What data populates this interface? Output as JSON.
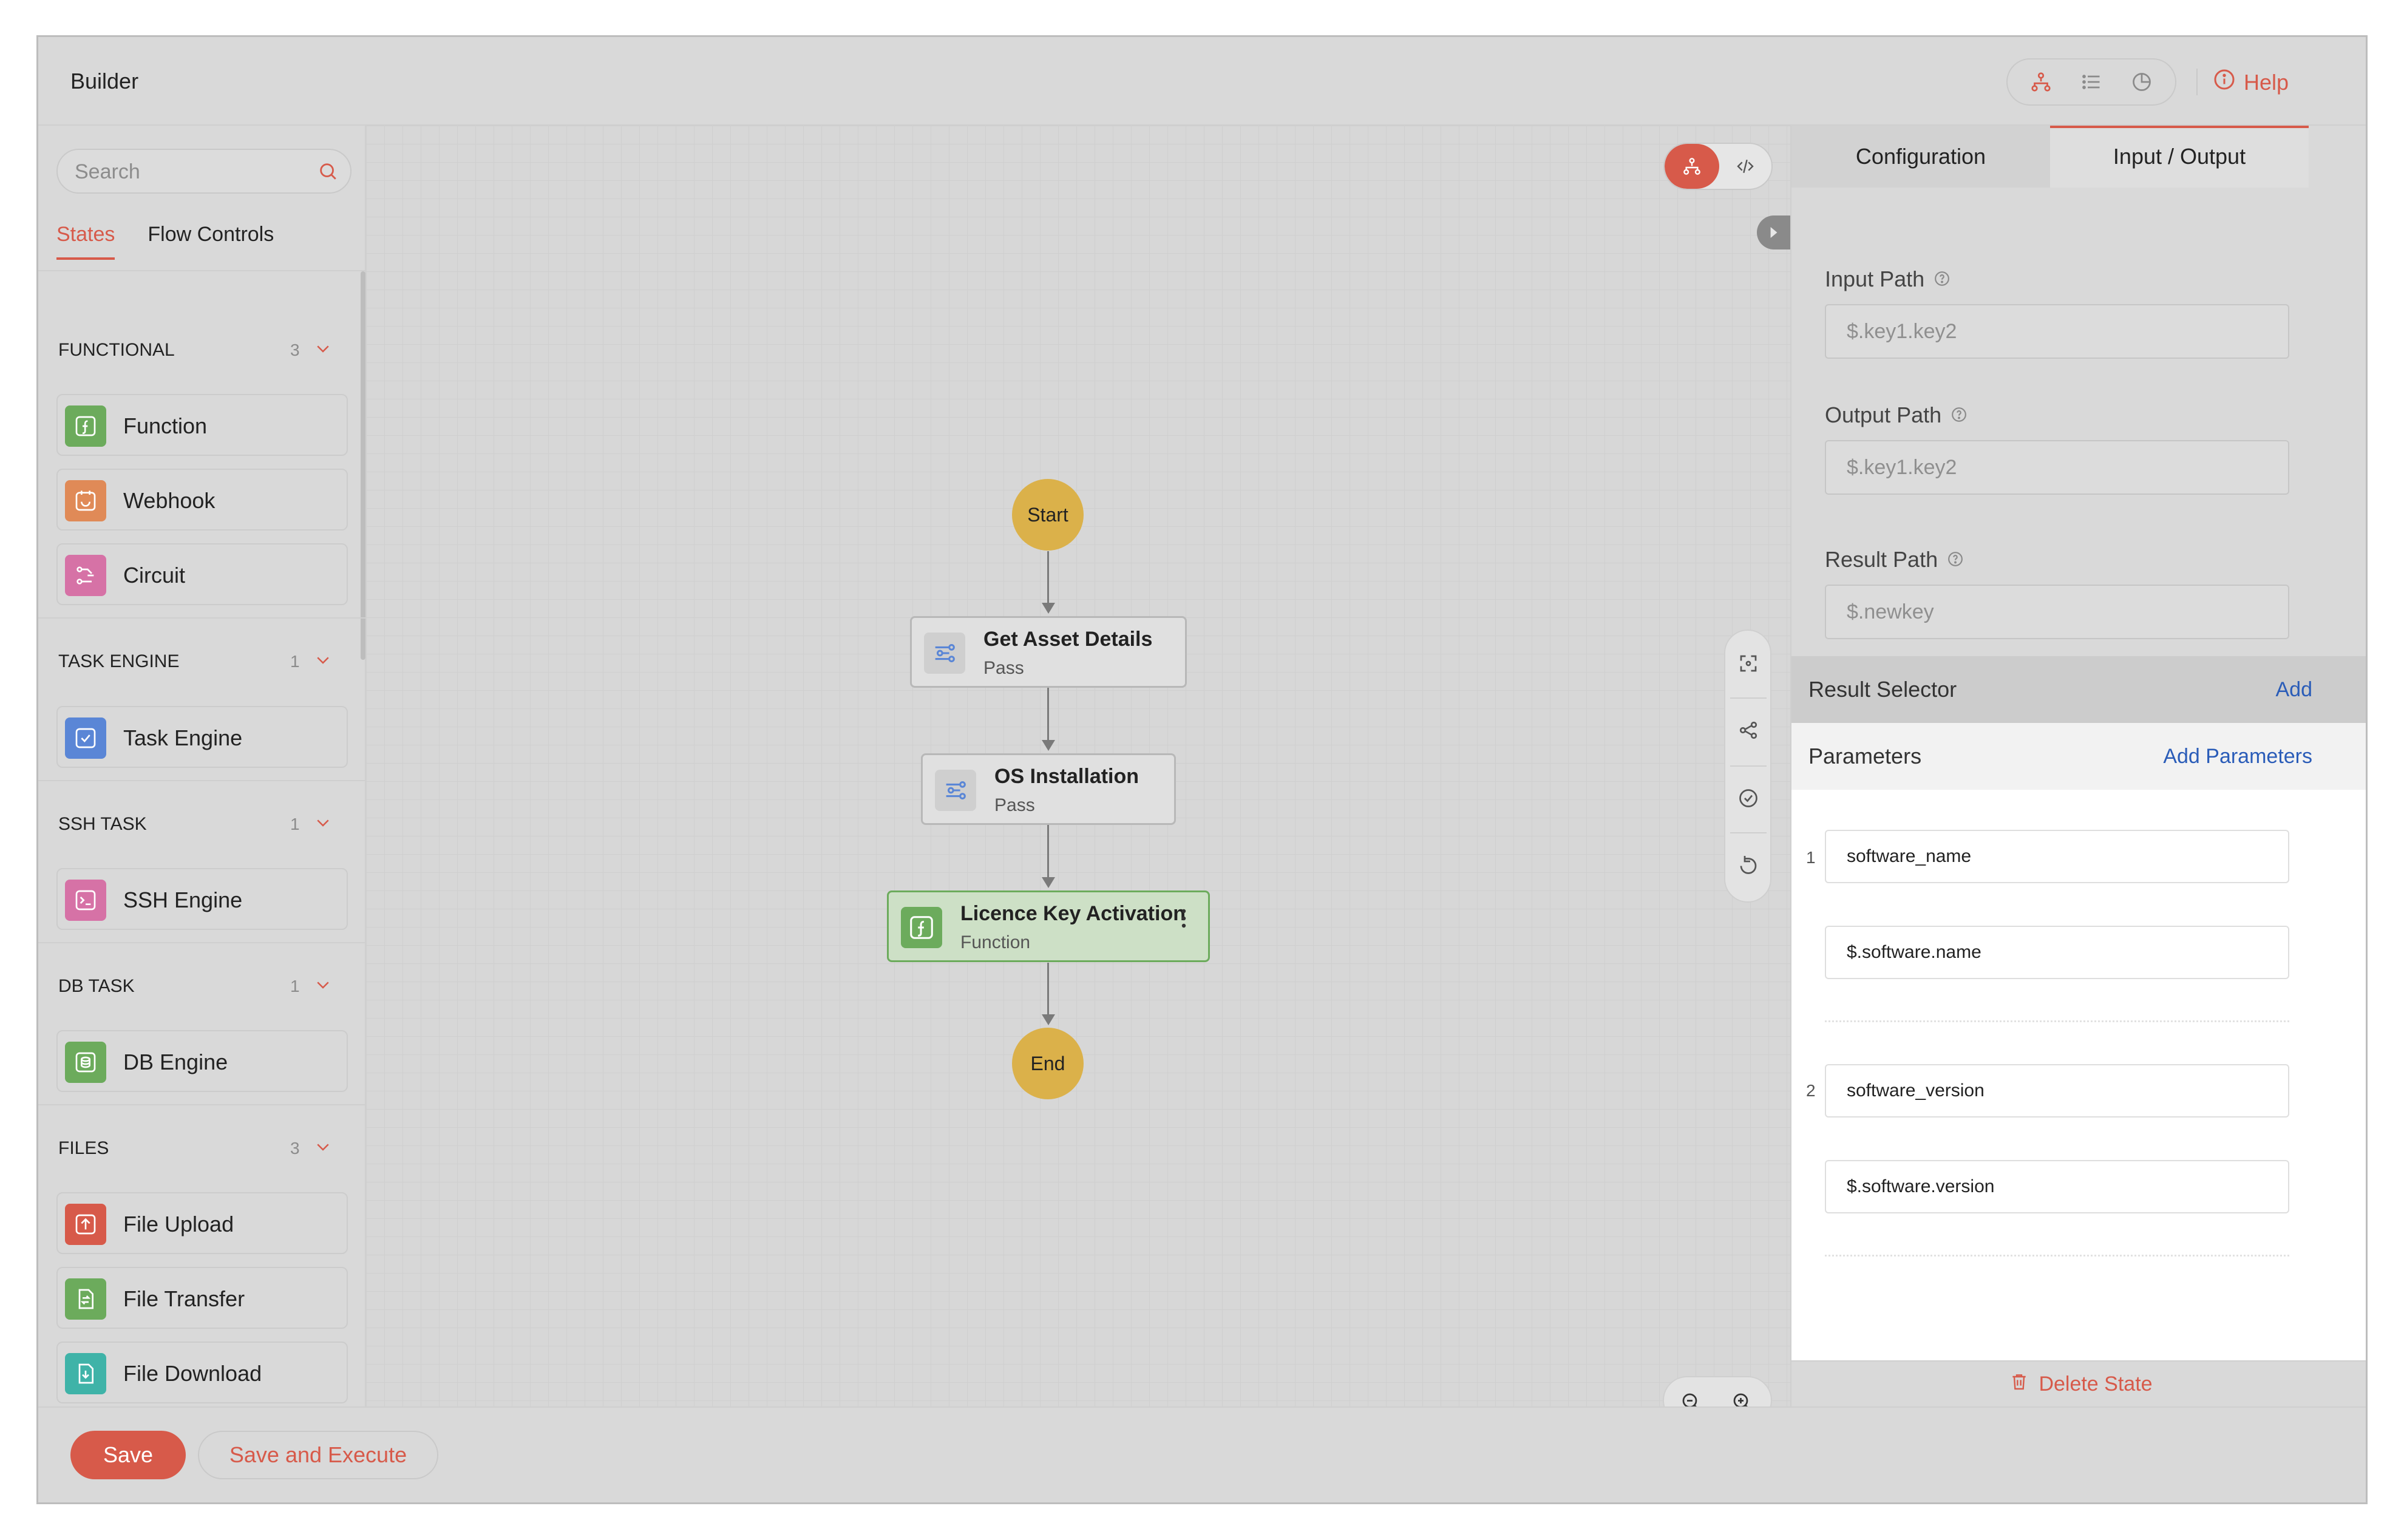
{
  "app": {
    "title": "Builder"
  },
  "topbar": {
    "view_icons": [
      "workflow-icon",
      "list-icon",
      "history-icon"
    ],
    "help_label": "Help"
  },
  "sidebar": {
    "search_placeholder": "Search",
    "tabs": [
      {
        "label": "States",
        "active": true
      },
      {
        "label": "Flow Controls",
        "active": false
      }
    ],
    "categories": [
      {
        "name": "FUNCTIONAL",
        "count": "3",
        "items": [
          {
            "label": "Function",
            "icon": "function-icon",
            "color": "#6cab5c"
          },
          {
            "label": "Webhook",
            "icon": "webhook-icon",
            "color": "#e08a57"
          },
          {
            "label": "Circuit",
            "icon": "circuit-icon",
            "color": "#d672a6"
          }
        ]
      },
      {
        "name": "TASK ENGINE",
        "count": "1",
        "items": [
          {
            "label": "Task Engine",
            "icon": "task-engine-icon",
            "color": "#5a86d6"
          }
        ]
      },
      {
        "name": "SSH TASK",
        "count": "1",
        "items": [
          {
            "label": "SSH Engine",
            "icon": "ssh-icon",
            "color": "#d672a6"
          }
        ]
      },
      {
        "name": "DB TASK",
        "count": "1",
        "items": [
          {
            "label": "DB Engine",
            "icon": "database-icon",
            "color": "#6cab5c"
          }
        ]
      },
      {
        "name": "FILES",
        "count": "3",
        "items": [
          {
            "label": "File Upload",
            "icon": "file-upload-icon",
            "color": "#d75a4a"
          },
          {
            "label": "File Transfer",
            "icon": "file-transfer-icon",
            "color": "#6cab5c"
          },
          {
            "label": "File Download",
            "icon": "file-download-icon",
            "color": "#3fb3a8"
          }
        ]
      }
    ]
  },
  "canvas": {
    "start_label": "Start",
    "end_label": "End",
    "nodes": [
      {
        "title": "Get Asset Details",
        "type": "Pass",
        "selected": false
      },
      {
        "title": "OS Installation",
        "type": "Pass",
        "selected": false
      },
      {
        "title": "Licence Key Activation",
        "type": "Function",
        "selected": true
      }
    ]
  },
  "panel": {
    "tabs": [
      {
        "label": "Configuration",
        "active": false
      },
      {
        "label": "Input / Output",
        "active": true
      }
    ],
    "input_path": {
      "label": "Input Path",
      "placeholder": "$.key1.key2"
    },
    "output_path": {
      "label": "Output Path",
      "placeholder": "$.key1.key2"
    },
    "result_path": {
      "label": "Result Path",
      "placeholder": "$.newkey"
    },
    "result_selector": {
      "title": "Result Selector",
      "action": "Add"
    },
    "parameters": {
      "title": "Parameters",
      "action": "Add Parameters",
      "items": [
        {
          "index": "1",
          "key": "software_name",
          "value": "$.software.name"
        },
        {
          "index": "2",
          "key": "software_version",
          "value": "$.software.version"
        }
      ]
    },
    "delete_label": "Delete State"
  },
  "footer": {
    "save_label": "Save",
    "save_execute_label": "Save and Execute"
  },
  "colors": {
    "accent": "#d75a4a",
    "link": "#2a5cb8",
    "start_end": "#dbb14a",
    "selected_node": "#6cab5c"
  }
}
